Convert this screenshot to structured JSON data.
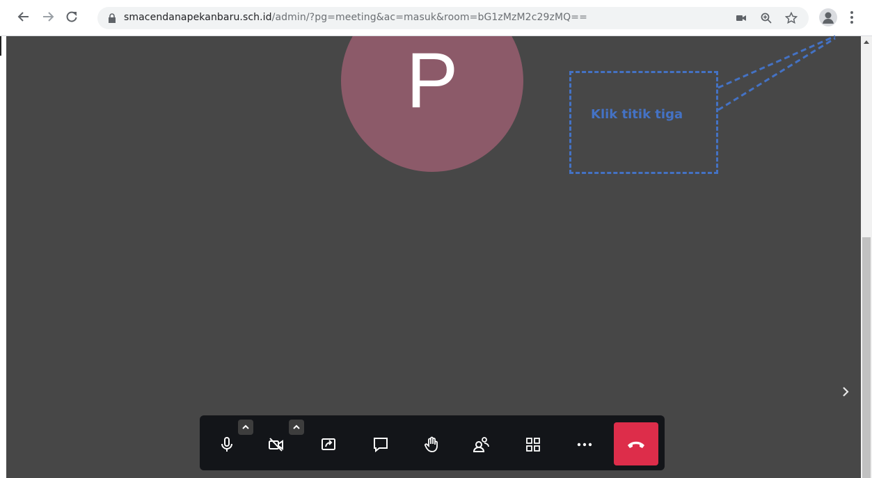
{
  "browser": {
    "url_host": "smacendanapekanbaru.sch.id",
    "url_path": "/admin/?pg=meeting&ac=masuk&room=bG1zMzM2c29zMQ==",
    "icons": [
      "back-arrow-icon",
      "forward-arrow-icon",
      "reload-icon",
      "lock-icon",
      "camera-icon",
      "zoom-icon",
      "star-icon",
      "profile-icon",
      "kebab-menu-icon"
    ]
  },
  "meeting": {
    "avatar_letter": "P",
    "avatar_color": "#8c5a69",
    "background_color": "#474747"
  },
  "toolbar": {
    "buttons": [
      "microphone",
      "camera-off",
      "share-screen",
      "chat",
      "raise-hand",
      "participants",
      "tile-view",
      "more-actions",
      "leave-call"
    ],
    "hangup_color": "#dd2d4a"
  },
  "annotation": {
    "text": "Klik titik tiga",
    "color": "#4472c4"
  }
}
